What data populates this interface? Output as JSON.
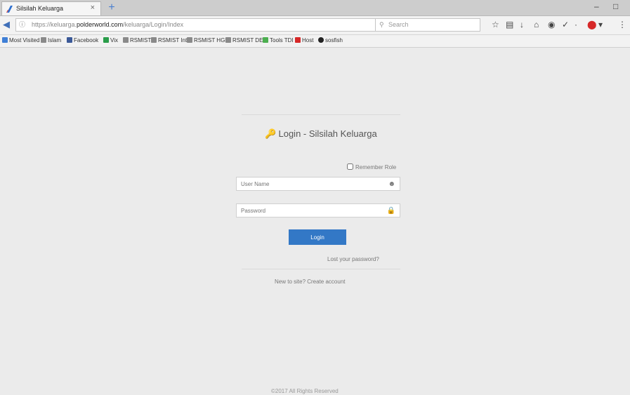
{
  "browser": {
    "tab_title": "Silsilah Keluarga",
    "tab_close": "×",
    "new_tab": "+",
    "url_prefix": "https://keluarga.",
    "url_domain": "polderworld.com",
    "url_path": "/keluarga/Login/Index",
    "search_placeholder": "Search",
    "window_controls": {
      "minimize": "–",
      "maximize": "□"
    }
  },
  "bookmarks": [
    {
      "label": "Most Visited",
      "color": "#3f7fd6"
    },
    {
      "label": "Islam",
      "color": "#8a8a8a"
    },
    {
      "label": "Facebook",
      "color": "#3b5998"
    },
    {
      "label": "Vix",
      "color": "#2a9d4a"
    },
    {
      "label": "RSMIST",
      "color": "#8a8a8a"
    },
    {
      "label": "RSMIST Int",
      "color": "#8a8a8a"
    },
    {
      "label": "RSMIST HGH",
      "color": "#8a8a8a"
    },
    {
      "label": "RSMIST DEV",
      "color": "#8a8a8a"
    },
    {
      "label": "Tools TDI",
      "color": "#4caf50"
    },
    {
      "label": "Host",
      "color": "#d62828"
    },
    {
      "label": "sosfish",
      "color": "#222222"
    }
  ],
  "login": {
    "title": "Login - Silsilah Keluarga",
    "remember_label": "Remember Role",
    "username_placeholder": "User Name",
    "password_placeholder": "Password",
    "submit_label": "Login",
    "lost_password": "Lost your password?",
    "new_here": "New to site? Create account",
    "footer": "©2017 All Rights Reserved"
  },
  "colors": {
    "accent": "#3378c6",
    "page_bg": "#ebebeb"
  }
}
